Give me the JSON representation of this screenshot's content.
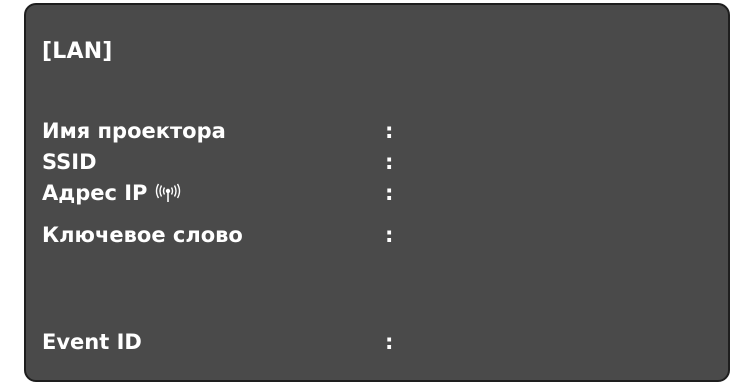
{
  "section_title": "[LAN]",
  "separator": ":",
  "rows": [
    {
      "label": "Имя проектора"
    },
    {
      "label": "SSID"
    },
    {
      "label": "Адрес IP",
      "icon": "wireless-signal-icon"
    },
    {
      "label": "Ключевое слово"
    },
    {
      "label": "Event ID"
    }
  ],
  "colors": {
    "background": "#4a4a4a",
    "border": "#1e1e1e",
    "text": "#ffffff"
  }
}
